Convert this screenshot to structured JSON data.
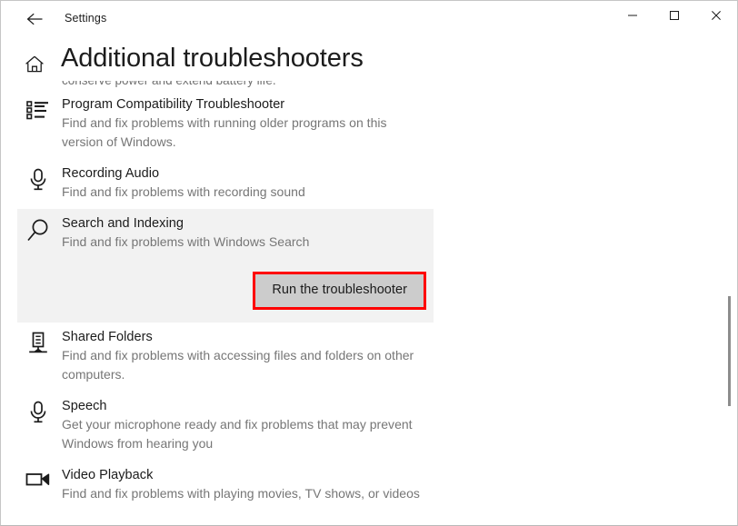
{
  "window": {
    "app_title": "Settings",
    "back_label": "Back",
    "caption": {
      "minimize": "Minimize",
      "maximize": "Maximize",
      "close": "Close"
    }
  },
  "header": {
    "home_icon": "home-icon",
    "page_title": "Additional troubleshooters"
  },
  "content": {
    "clipped_text": "conserve power and extend battery life.",
    "items": [
      {
        "icon": "list-icon",
        "name": "Program Compatibility Troubleshooter",
        "desc": "Find and fix problems with running older programs on this version of Windows."
      },
      {
        "icon": "microphone-icon",
        "name": "Recording Audio",
        "desc": "Find and fix problems with recording sound"
      },
      {
        "icon": "search-icon",
        "name": "Search and Indexing",
        "desc": "Find and fix problems with Windows Search",
        "selected": true,
        "button_label": "Run the troubleshooter"
      },
      {
        "icon": "server-icon",
        "name": "Shared Folders",
        "desc": "Find and fix problems with accessing files and folders on other computers."
      },
      {
        "icon": "microphone-icon",
        "name": "Speech",
        "desc": "Get your microphone ready and fix problems that may prevent Windows from hearing you"
      },
      {
        "icon": "video-camera-icon",
        "name": "Video Playback",
        "desc": "Find and fix problems with playing movies, TV shows, or videos"
      }
    ]
  },
  "colors": {
    "highlight_background": "#f2f2f2",
    "button_fill": "#cccccc",
    "annotation_border": "#fe0000",
    "title_text": "#1b1b1b",
    "description_text": "#767676",
    "scrollbar_thumb": "#8d8d8d"
  }
}
